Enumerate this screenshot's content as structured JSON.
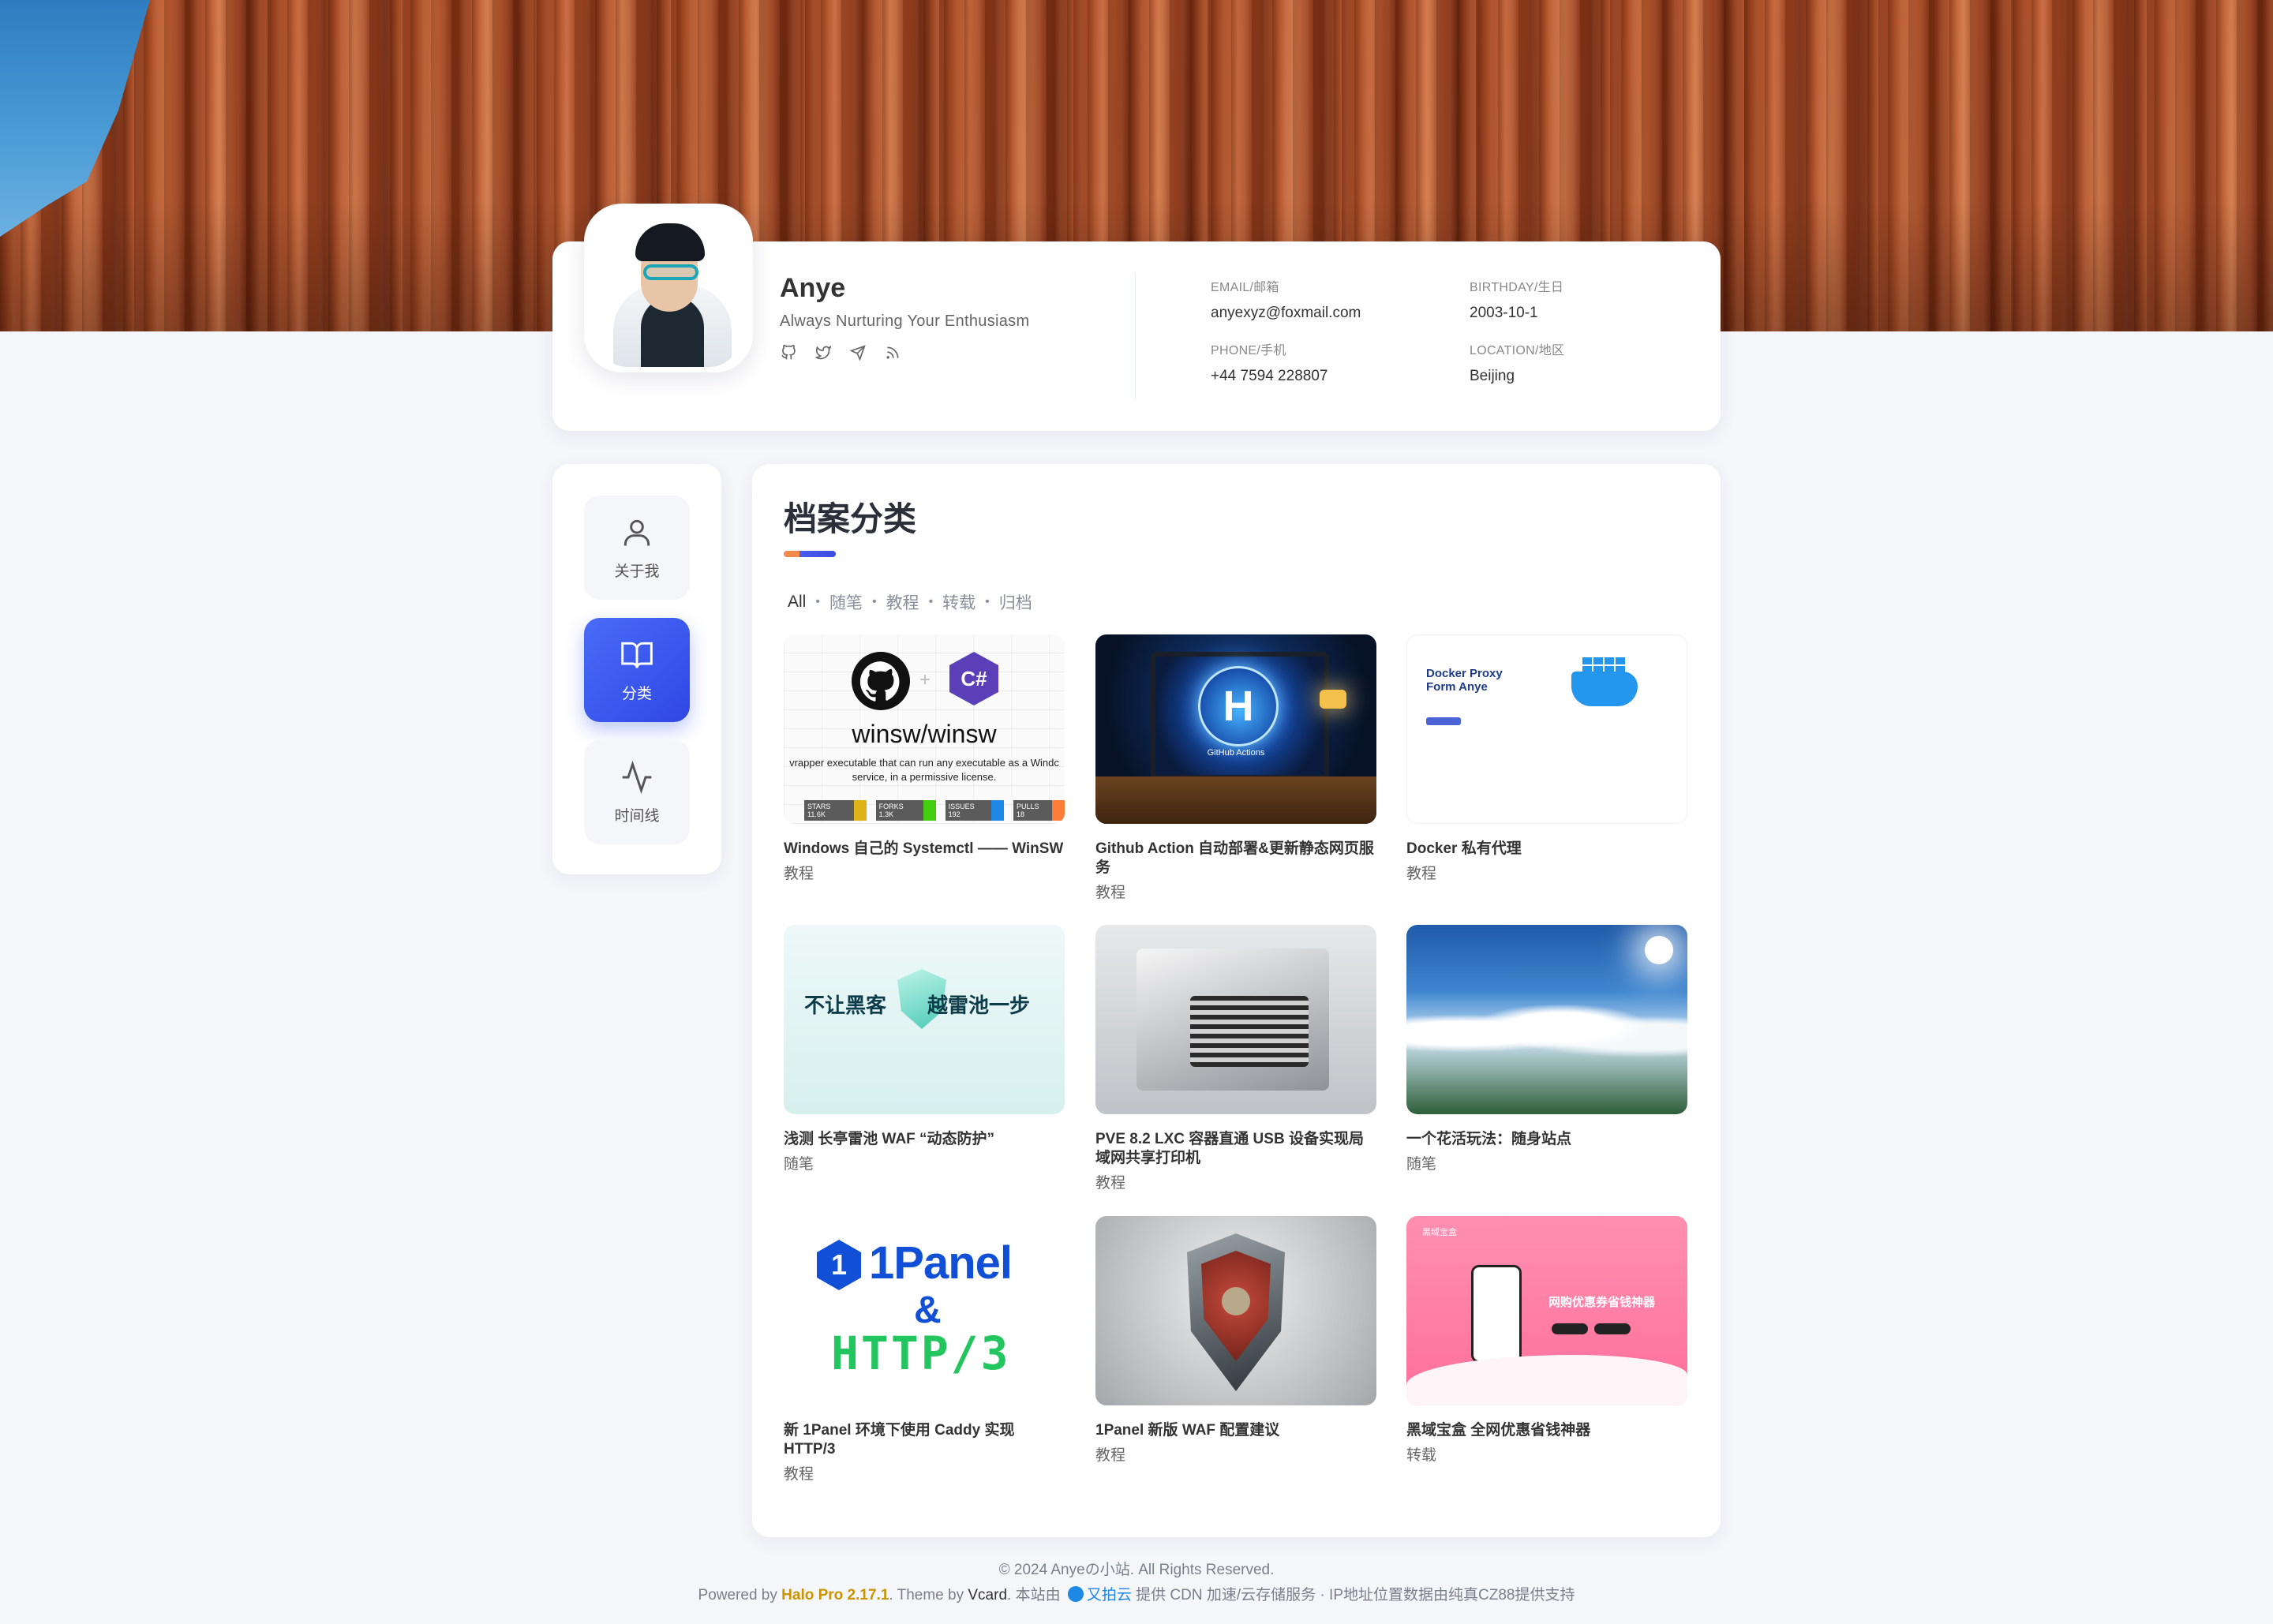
{
  "profile": {
    "name": "Anye",
    "motto": "Always Nurturing Your Enthusiasm",
    "social_icons": [
      "github-icon",
      "twitter-icon",
      "telegram-icon",
      "rss-icon"
    ],
    "email_label": "EMAIL/邮箱",
    "email": "anyexyz@foxmail.com",
    "birthday_label": "BIRTHDAY/生日",
    "birthday": "2003-10-1",
    "phone_label": "PHONE/手机",
    "phone": "+44 7594 228807",
    "location_label": "LOCATION/地区",
    "location": "Beijing"
  },
  "nav": {
    "items": [
      {
        "label": "关于我",
        "icon": "user-icon"
      },
      {
        "label": "分类",
        "icon": "book-icon",
        "active": true
      },
      {
        "label": "时间线",
        "icon": "activity-icon"
      }
    ]
  },
  "main": {
    "title": "档案分类",
    "filters": [
      "All",
      "随笔",
      "教程",
      "转载",
      "归档"
    ],
    "active_filter": "All",
    "posts": [
      {
        "title": "Windows 自己的 Systemctl —— WinSW",
        "category": "教程",
        "thumb": {
          "repo": "winsw/winsw",
          "desc_line1": "vrapper executable that can run any executable as a Windc",
          "desc_line2": "service, in a permissive license.",
          "badges": [
            "STARS 11.6K",
            "FORKS 1.3K",
            "ISSUES 192",
            "PULLS 18"
          ]
        }
      },
      {
        "title": "Github Action 自动部署&更新静态网页服务",
        "category": "教程",
        "thumb": {
          "caption": "GitHub Actions"
        }
      },
      {
        "title": "Docker 私有代理",
        "category": "教程",
        "thumb": {
          "heading1": "Docker Proxy",
          "heading2": "Form Anye"
        }
      },
      {
        "title": "浅测 长亭雷池 WAF “动态防护”",
        "category": "随笔",
        "thumb": {
          "left": "不让黑客",
          "right": "越雷池一步"
        }
      },
      {
        "title": "PVE 8.2 LXC 容器直通 USB 设备实现局域网共享打印机",
        "category": "教程",
        "thumb": {}
      },
      {
        "title": "一个花活玩法：随身站点",
        "category": "随笔",
        "thumb": {}
      },
      {
        "title": "新 1Panel 环境下使用 Caddy 实现 HTTP/3",
        "category": "教程",
        "thumb": {
          "line1": "1Panel",
          "amp": "&",
          "line2": "HTTP/3"
        }
      },
      {
        "title": "1Panel 新版 WAF 配置建议",
        "category": "教程",
        "thumb": {}
      },
      {
        "title": "黑域宝盒 全网优惠省钱神器",
        "category": "转载",
        "thumb": {
          "tag": "黑域宝盒",
          "heading": "网购优惠券省钱神器"
        }
      }
    ]
  },
  "footer": {
    "copyright": "© 2024 Anyeの小站. All Rights Reserved.",
    "powered_prefix": "Powered by",
    "halo": "Halo Pro 2.17.1",
    "theme_prefix": ". Theme by",
    "theme": "Vcard",
    "cdn_prefix": ". 本站由",
    "cdn_name": "又拍云",
    "cdn_suffix": "提供 CDN 加速/云存储服务 · IP地址位置数据由纯真CZ88提供支持"
  }
}
